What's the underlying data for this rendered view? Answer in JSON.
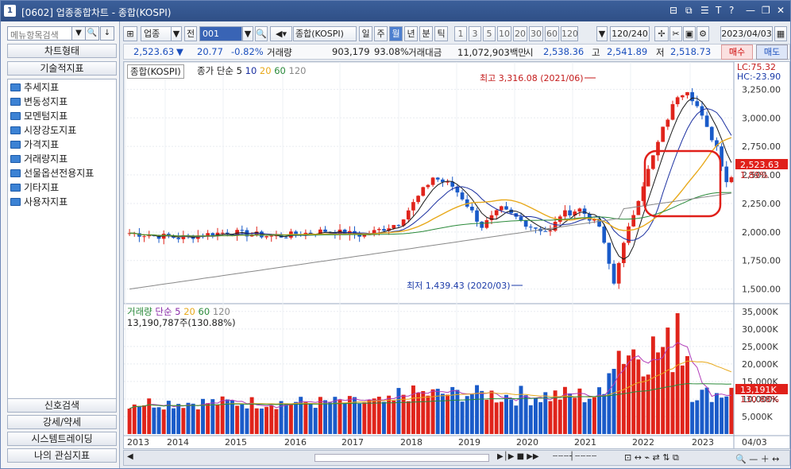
{
  "window": {
    "number": "1",
    "title": "[0602] 업종종합차트 - 종합(KOSPI)"
  },
  "sidebar": {
    "search_placeholder": "메뉴항목검색",
    "chart_type_label": "차트형태",
    "tech_indicators_label": "기술적지표",
    "tree": [
      "추세지표",
      "변동성지표",
      "모멘텀지표",
      "시장강도지표",
      "가격지표",
      "거래량지표",
      "선물옵션전용지표",
      "기타지표",
      "사용자지표"
    ],
    "bottom": [
      "신호검색",
      "강세/약세",
      "시스템트레이딩",
      "나의 관심지표"
    ]
  },
  "toolbar": {
    "sector_select": "업종",
    "jeon_label": "전",
    "code_value": "001",
    "name_value": "종합(KOSPI)",
    "periods": [
      "일",
      "주",
      "월",
      "년",
      "분",
      "틱"
    ],
    "period_selected": "월",
    "intervals": [
      "1",
      "3",
      "5",
      "10",
      "20",
      "30",
      "60",
      "120"
    ],
    "count_value": "120/240",
    "date_value": "2023/04/03"
  },
  "quote": {
    "price": "2,523.63",
    "change": "20.77",
    "change_pct": "-0.82%",
    "volume_label": "거래량",
    "volume": "903,179",
    "volume_pct": "93.08%",
    "amount_label": "거래대금",
    "amount": "11,072,903백만",
    "si_label": "시",
    "open": "2,538.36",
    "go_label": "고",
    "high": "2,541.89",
    "jeo_label": "저",
    "low": "2,518.73",
    "buy_label": "매수",
    "sell_label": "매도"
  },
  "price_legend": {
    "name": "종합(KOSPI)",
    "ma_label": "종가 단순",
    "periods": [
      "5",
      "10",
      "20",
      "60",
      "120"
    ]
  },
  "volume_legend": {
    "name": "거래량",
    "ma_label": "단순",
    "periods": [
      "5",
      "20",
      "60",
      "120"
    ],
    "current": "13,190,787주(130.88%)"
  },
  "annotations": {
    "high": "최고 3,316.08 (2021/06)",
    "low": "최저 1,439.43 (2020/03)",
    "lc": "LC:75.32",
    "hc": "HC:-23.90",
    "price_tag": "2,523.63",
    "price_pct": "1.89%",
    "vol_tag": "13,191K",
    "vol_pct": "130.88%"
  },
  "chart_data": {
    "type": "candlestick+bar",
    "price_axis": [
      "3,250.00",
      "3,000.00",
      "2,750.00",
      "2,500.00",
      "2,250.00",
      "2,000.00",
      "1,750.00",
      "1,500.00"
    ],
    "volume_axis": [
      "35,000K",
      "30,000K",
      "25,000K",
      "20,000K",
      "15,000K",
      "10,000K",
      "5,000K"
    ],
    "x_labels": [
      "2013",
      "2014",
      "2015",
      "2016",
      "2017",
      "2018",
      "2019",
      "2020",
      "2021",
      "2022",
      "2023"
    ],
    "x_end_label": "04/03",
    "price_range": [
      1400,
      3350
    ],
    "volume_range": [
      0,
      37000
    ],
    "colors": {
      "up": "#e0241b",
      "down": "#1a5bc9",
      "ma5": "#1a1a1a",
      "ma10": "#1a2fa0",
      "ma20": "#e8a91b",
      "ma60": "#2a8a3a",
      "ma120": "#888888"
    }
  }
}
